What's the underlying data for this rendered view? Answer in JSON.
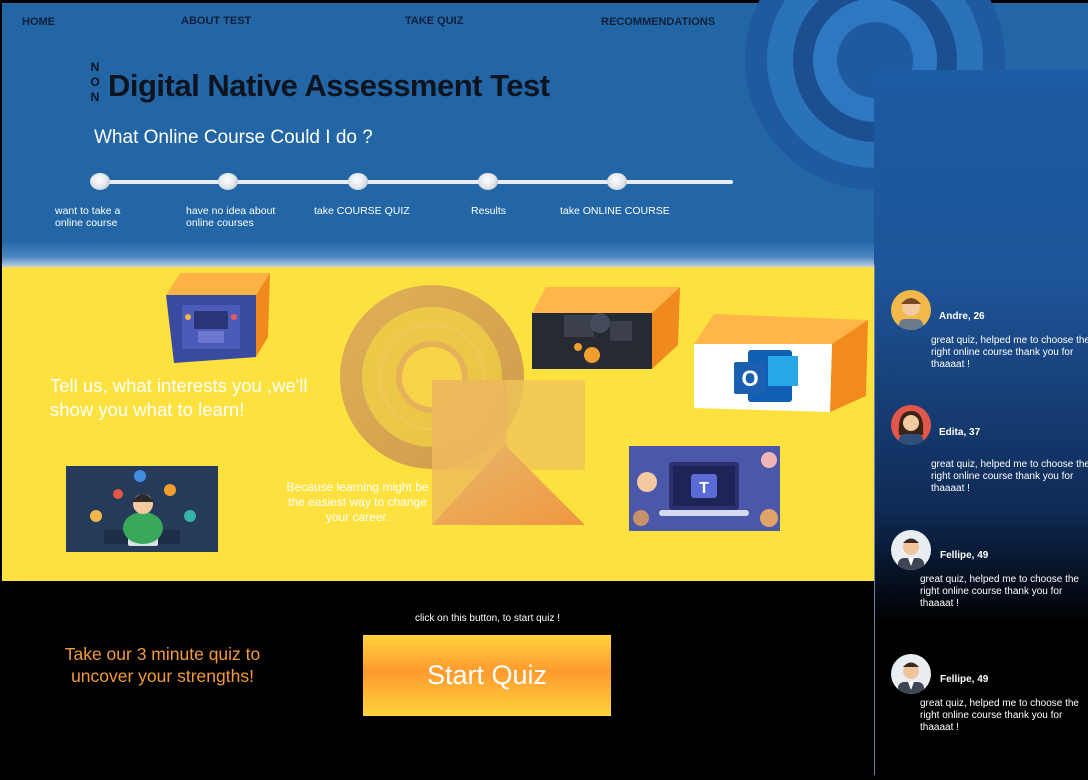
{
  "nav": {
    "home": "HOME",
    "about": "ABOUT TEST",
    "quiz": "TAKE QUIZ",
    "recommendations": "RECOMMENDATIONS"
  },
  "hero": {
    "title_prefix": "NON",
    "title": "Digital Native Assessment Test",
    "subtitle": "What Online Course Could I do ?",
    "steps": [
      "want to take a online course",
      "have no idea about online courses",
      "take COURSE QUIZ",
      "Results",
      "take ONLINE COURSE"
    ]
  },
  "content": {
    "tagline": "Tell us, what interests you ,we'll show you what to learn!",
    "because": "Because learning  might be the easiest way to change your career.",
    "outlook_letter": "O",
    "teams_letter": "T"
  },
  "cta": {
    "note": "click on this button, to start quiz !",
    "promo": "Take our 3 minute quiz to uncover your strengths!",
    "button_label": "Start Quiz"
  },
  "testimonials": [
    {
      "name": "Andre, 26",
      "text": "great quiz, helped me to choose the right online course thank you for thaaaat !"
    },
    {
      "name": "Edita, 37",
      "text": "great quiz, helped me to choose the right online course thank you for thaaaat !"
    },
    {
      "name": "Fellipe, 49",
      "text": "great quiz, helped me to choose the right online course thank you for thaaaat !"
    },
    {
      "name": "Fellipe, 49",
      "text": "great quiz, helped me to choose the right online course thank you for thaaaat !"
    }
  ],
  "colors": {
    "hero_blue": "#2266a6",
    "yellow": "#fde23f",
    "accent_orange": "#f39a3c"
  }
}
